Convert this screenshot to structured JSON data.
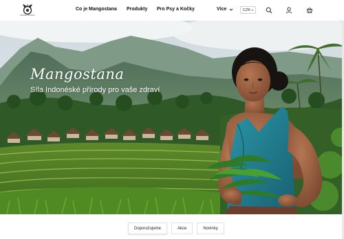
{
  "header": {
    "logo_text": "MANGOSTANA",
    "nav": [
      {
        "label": "Co je Mangostana"
      },
      {
        "label": "Produkty"
      },
      {
        "label": "Pro Psy a Kočky"
      },
      {
        "label": "Více"
      }
    ],
    "currency": "CZK",
    "icons": [
      "search-icon",
      "user-icon",
      "cart-icon"
    ]
  },
  "hero": {
    "title": "Mangostana",
    "subtitle": "Síla Indonéské přírody pro vaše zdraví"
  },
  "tabs": [
    {
      "label": "Doporučujeme",
      "active": true
    },
    {
      "label": "Akce",
      "active": false
    },
    {
      "label": "Novinky",
      "active": false
    }
  ],
  "colors": {
    "sky": "#dfe8ec",
    "mountain": "#5b7c63",
    "jungle": "#2f5a27",
    "terrace": "#7fa83a",
    "dress": "#1e7a8c",
    "skin": "#9a6244",
    "hair": "#161311"
  }
}
